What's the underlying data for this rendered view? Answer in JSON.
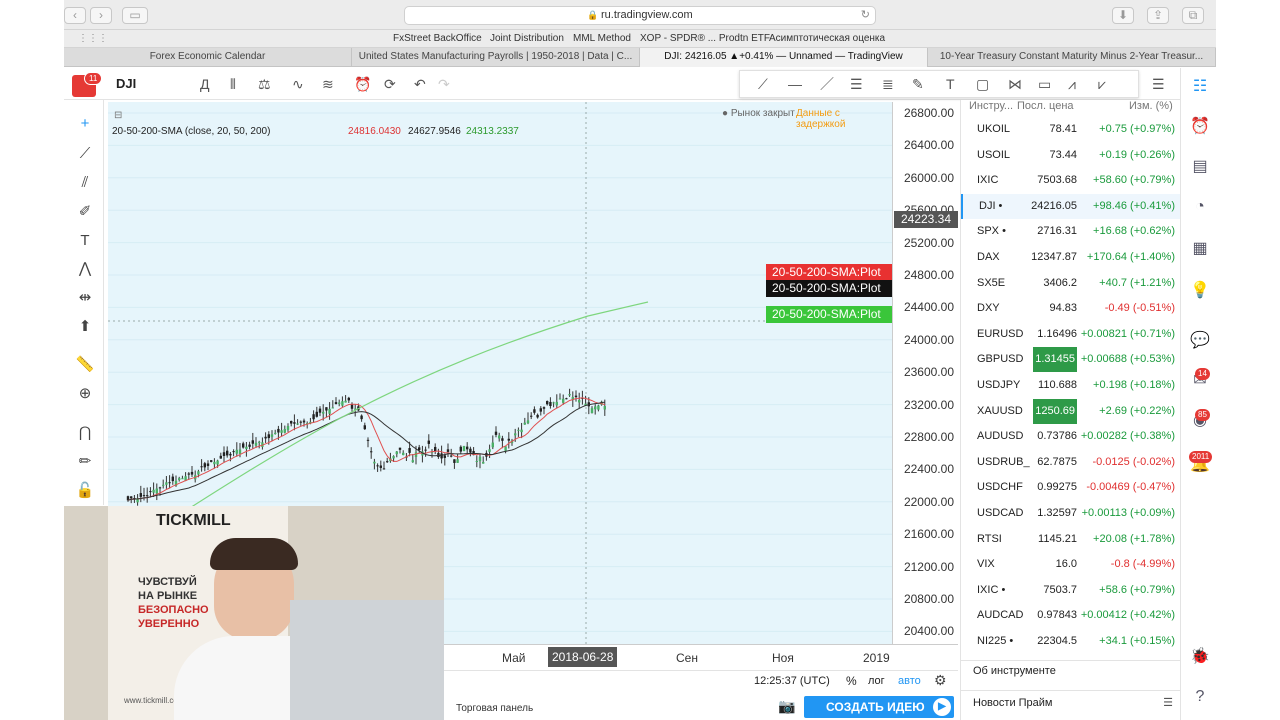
{
  "browser": {
    "url": "ru.tradingview.com",
    "bookmarks": [
      "FxStreet BackOffice",
      "Joint Distribution",
      "MML Method",
      "XOP - SPDR® ... Prodtn ETF",
      "Асимптотическая оценка"
    ],
    "tabs": [
      "Forex Economic Calendar",
      "United States Manufacturing Payrolls | 1950-2018 | Data | C...",
      "DJI: 24216.05 ▲+0.41% — Unnamed — TradingView",
      "10-Year Treasury Constant Maturity Minus 2-Year Treasur..."
    ]
  },
  "tv": {
    "logo_badge": "11",
    "symbol": "DJI",
    "interval": "Д",
    "indicator": "20-50-200-SMA (close, 20, 50, 200)",
    "ind_values": [
      "24816.0430",
      "24627.9546",
      "24313.2337"
    ],
    "market_status": "Рынок закрыт",
    "delay": "Данные с задержкой",
    "plot_labels": [
      "20-50-200-SMA:Plot",
      "20-50-200-SMA:Plot",
      "20-50-200-SMA:Plot"
    ],
    "price_tag": "24223.34",
    "price_ticks": [
      "26800.00",
      "26400.00",
      "26000.00",
      "25600.00",
      "25200.00",
      "24800.00",
      "24400.00",
      "24000.00",
      "23600.00",
      "23200.00",
      "22800.00",
      "22400.00",
      "22000.00",
      "21600.00",
      "21200.00",
      "20800.00",
      "20400.00"
    ],
    "time_ticks": [
      "Май",
      "2018-06-28",
      "Сен",
      "Ноя",
      "2019"
    ],
    "clock": "12:25:37 (UTC)",
    "pct": "%",
    "log": "лог",
    "auto": "авто",
    "trade_panel": "Торговая панель",
    "create_idea": "СОЗДАТЬ ИДЕЮ"
  },
  "watchlist": {
    "headers": [
      "Инстру...",
      "Посл. цена",
      "Изм. (%)"
    ],
    "rows": [
      {
        "sym": "UKOIL",
        "last": "78.41",
        "chg": "+0.75 (+0.97%)",
        "up": true
      },
      {
        "sym": "USOIL",
        "last": "73.44",
        "chg": "+0.19 (+0.26%)",
        "up": true
      },
      {
        "sym": "IXIC",
        "last": "7503.68",
        "chg": "+58.60 (+0.79%)",
        "up": true
      },
      {
        "sym": "DJI •",
        "last": "24216.05",
        "chg": "+98.46 (+0.41%)",
        "up": true
      },
      {
        "sym": "SPX •",
        "last": "2716.31",
        "chg": "+16.68 (+0.62%)",
        "up": true
      },
      {
        "sym": "DAX",
        "last": "12347.87",
        "chg": "+170.64 (+1.40%)",
        "up": true
      },
      {
        "sym": "SX5E",
        "last": "3406.2",
        "chg": "+40.7 (+1.21%)",
        "up": true
      },
      {
        "sym": "DXY",
        "last": "94.83",
        "chg": "-0.49 (-0.51%)",
        "up": false
      },
      {
        "sym": "EURUSD",
        "last": "1.16496",
        "chg": "+0.00821 (+0.71%)",
        "up": true
      },
      {
        "sym": "GBPUSD",
        "last": "1.31455",
        "chg": "+0.00688 (+0.53%)",
        "up": true
      },
      {
        "sym": "USDJPY",
        "last": "110.688",
        "chg": "+0.198 (+0.18%)",
        "up": true
      },
      {
        "sym": "XAUUSD",
        "last": "1250.69",
        "chg": "+2.69 (+0.22%)",
        "up": true
      },
      {
        "sym": "AUDUSD",
        "last": "0.73786",
        "chg": "+0.00282 (+0.38%)",
        "up": true
      },
      {
        "sym": "USDRUB_",
        "last": "62.7875",
        "chg": "-0.0125 (-0.02%)",
        "up": false
      },
      {
        "sym": "USDCHF",
        "last": "0.99275",
        "chg": "-0.00469 (-0.47%)",
        "up": false
      },
      {
        "sym": "USDCAD",
        "last": "1.32597",
        "chg": "+0.00113 (+0.09%)",
        "up": true
      },
      {
        "sym": "RTSI",
        "last": "1145.21",
        "chg": "+20.08 (+1.78%)",
        "up": true
      },
      {
        "sym": "VIX",
        "last": "16.0",
        "chg": "-0.8 (-4.99%)",
        "up": false
      },
      {
        "sym": "IXIC •",
        "last": "7503.7",
        "chg": "+58.6 (+0.79%)",
        "up": true
      },
      {
        "sym": "AUDCAD",
        "last": "0.97843",
        "chg": "+0.00412 (+0.42%)",
        "up": true
      },
      {
        "sym": "NI225 •",
        "last": "22304.5",
        "chg": "+34.1 (+0.15%)",
        "up": true
      }
    ],
    "about": "Об инструменте",
    "news": "Новости Прайм"
  },
  "rightbar_badges": [
    "14",
    "85",
    "2011"
  ],
  "webcam": {
    "brand": "TICKMILL",
    "poster": [
      "ЧУВСТВУЙ",
      "НА РЫНКЕ",
      "БЕЗОПАСНО",
      "УВЕРЕННО"
    ],
    "site": "www.tickmill.com"
  },
  "colors": {
    "up": "#1a9a3c",
    "down": "#e03030",
    "accent": "#2196f3",
    "sma20": "#e05050",
    "sma50": "#333333",
    "sma200": "#7ed67e"
  }
}
